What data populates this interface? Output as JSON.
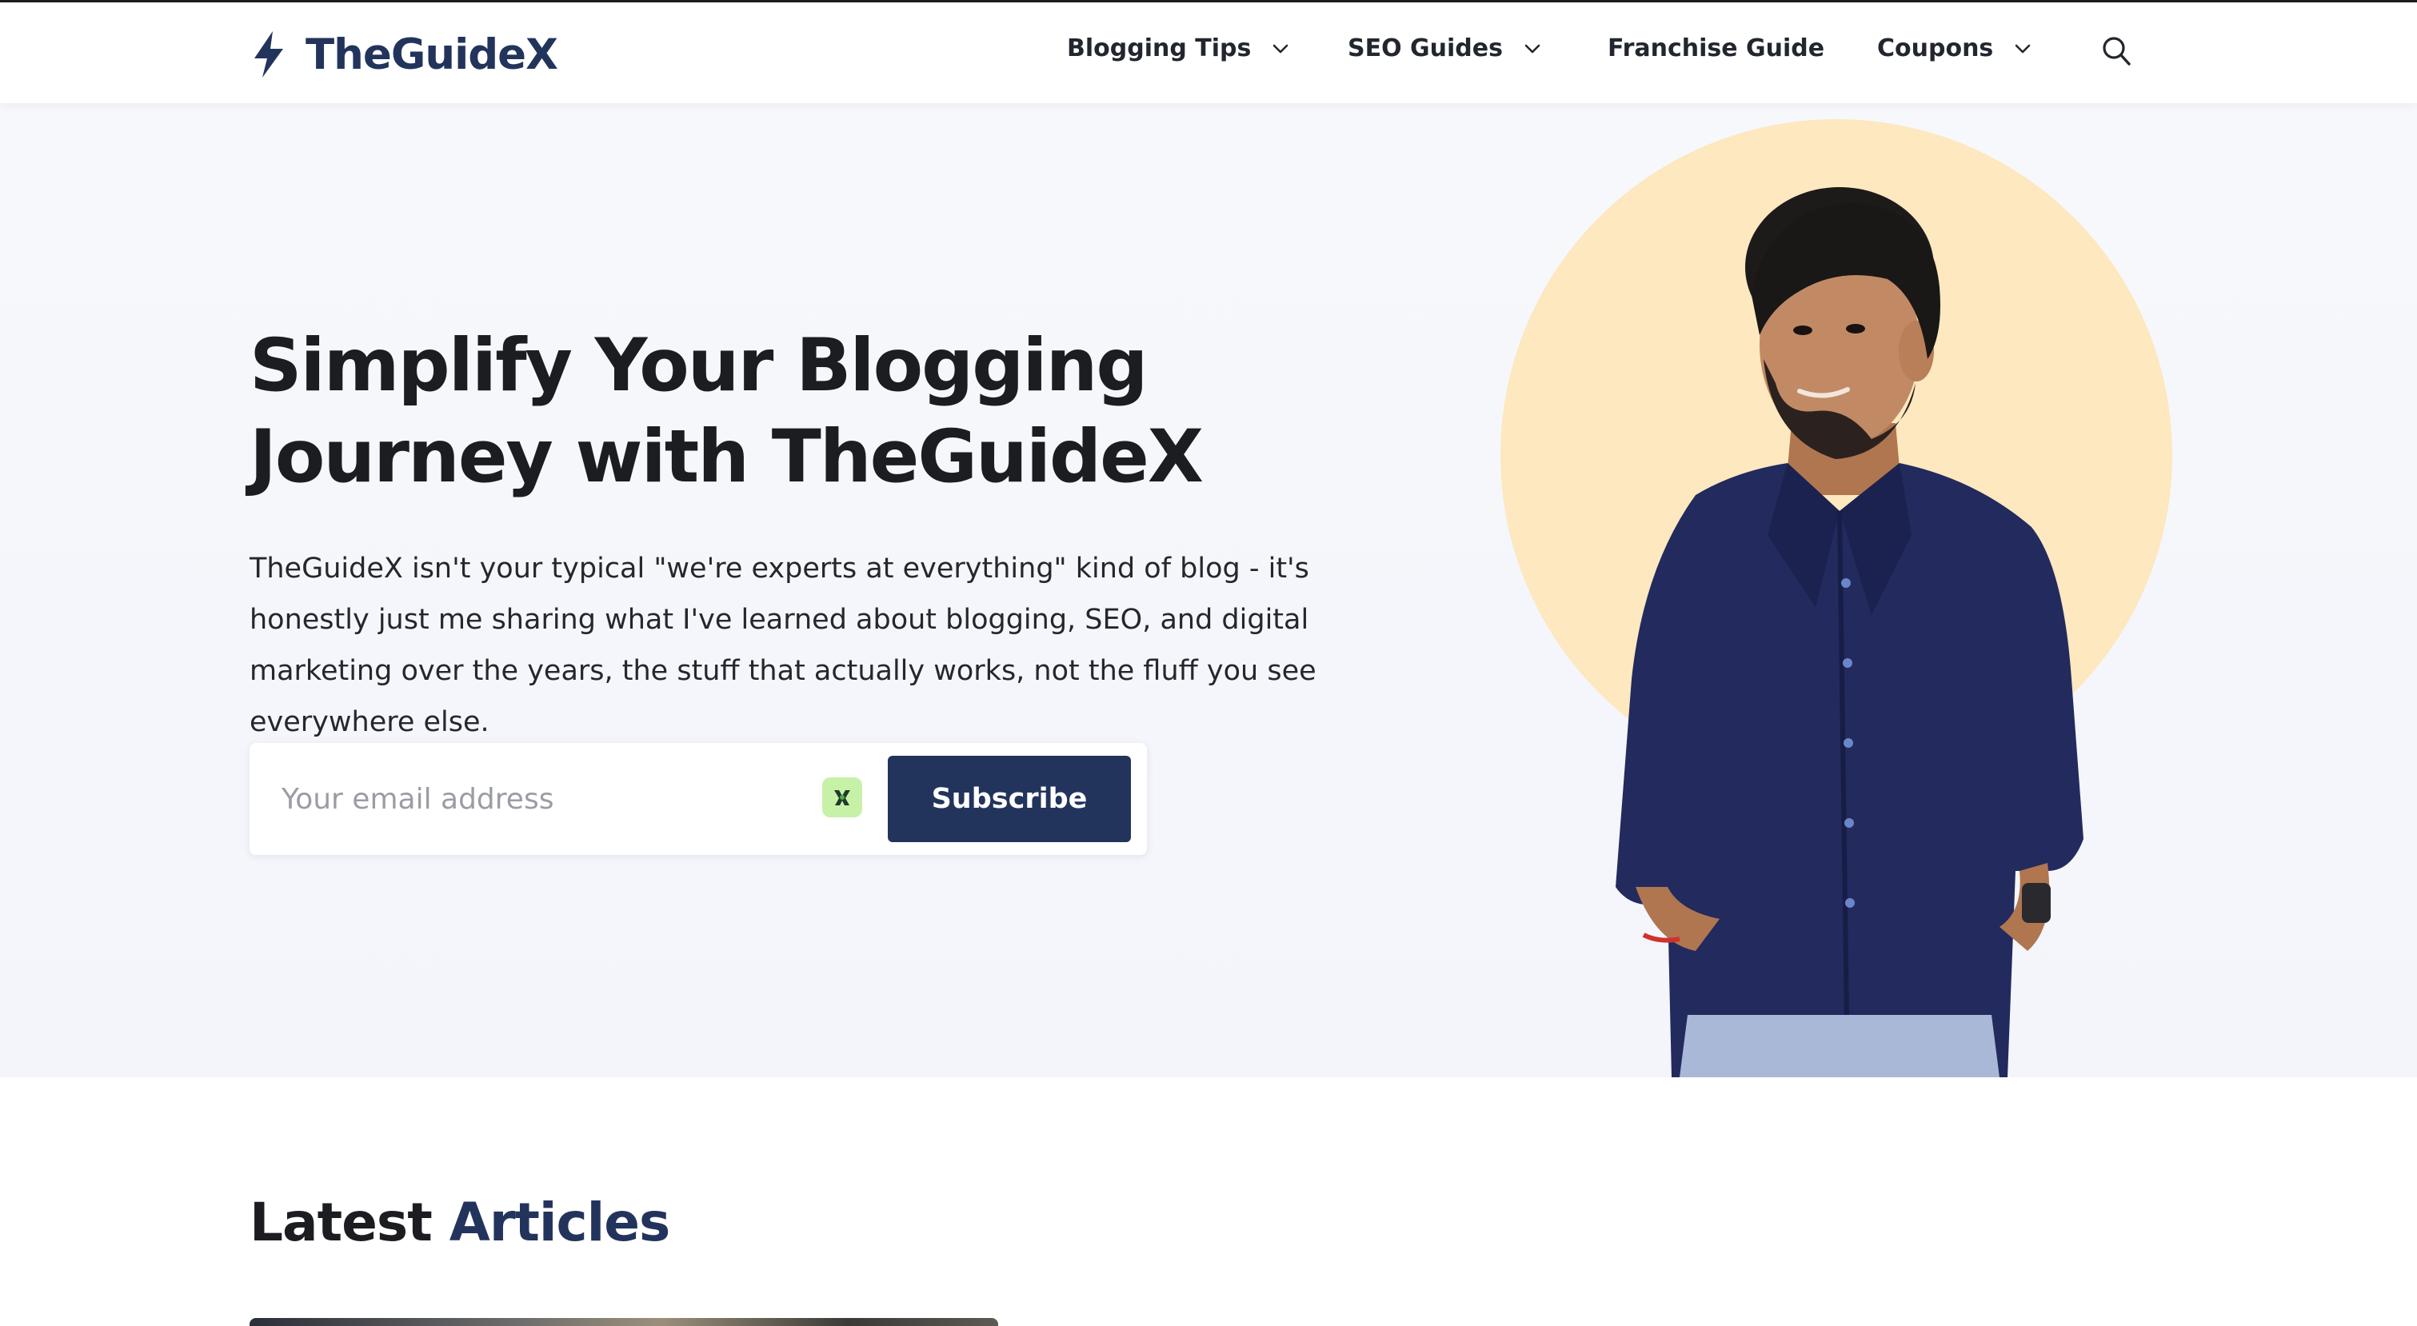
{
  "brand": {
    "name": "TheGuideX",
    "accent_color": "#23345c",
    "logo_icon": "lightning-bolt-icon"
  },
  "nav": {
    "items": [
      {
        "label": "Blogging Tips",
        "has_dropdown": true
      },
      {
        "label": "SEO Guides",
        "has_dropdown": true
      },
      {
        "label": "Franchise Guide",
        "has_dropdown": false
      },
      {
        "label": "Coupons",
        "has_dropdown": true
      }
    ],
    "search_icon": "search-icon"
  },
  "hero": {
    "title": "Simplify Your Blogging Journey with TheGuideX",
    "description": "TheGuideX isn't your typical \"we're experts at everything\" kind of blog - it's honestly just me sharing what I've learned about blogging, SEO, and digital marketing over the years, the stuff that actually works, not the fluff you see everywhere else.",
    "email_placeholder": "Your email address",
    "subscribe_label": "Subscribe",
    "circle_color": "#fde8bf",
    "extension_icon": "browser-extension-icon"
  },
  "latest": {
    "title_prefix": "Latest",
    "title_accent": "Articles"
  }
}
